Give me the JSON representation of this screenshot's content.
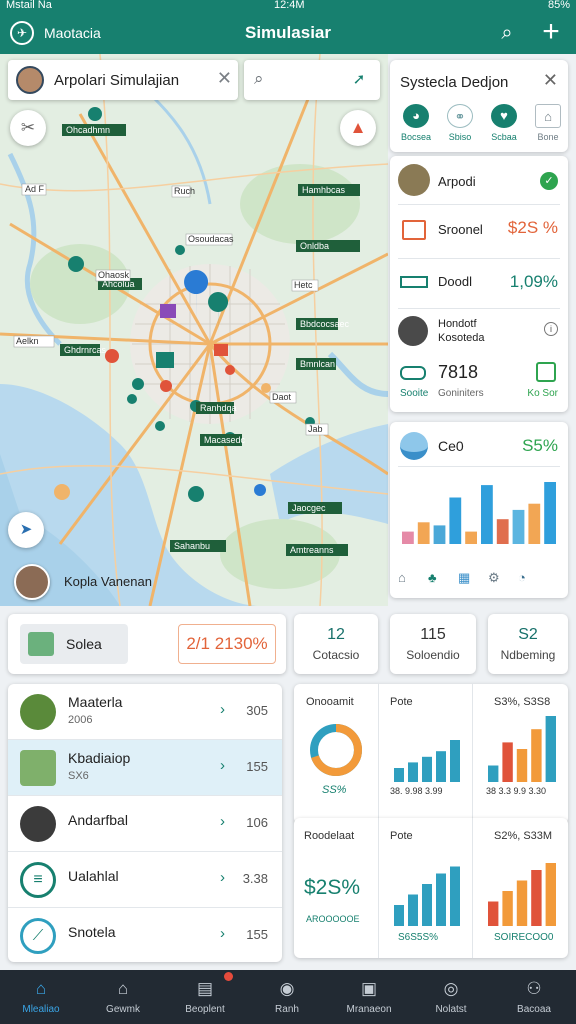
{
  "status_bar": {
    "left": "Mstail Na",
    "center": "12:4M",
    "right": "85%"
  },
  "header": {
    "app_name": "Maotacia",
    "title": "Simulasiar",
    "search_icon": "search-icon",
    "add_icon": "plus-icon"
  },
  "map": {
    "search_text": "Arpolari Simulajian",
    "user_label": "Kopla Vanenan",
    "labels": [
      "Ohcadhmn",
      "Hamhbcas",
      "Ahcolua",
      "Ghdrnrcas",
      "Onldba",
      "Bbdcocsaec",
      "Ranhdqa",
      "Macasedc",
      "Bmnlcan",
      "Jaocgec",
      "Sahanbu",
      "Amtreanns"
    ],
    "small_labels": [
      "Ad F",
      "Ruch",
      "Ohaosk",
      "Osoudacas",
      "Aelkn",
      "Hetc",
      "Jab",
      "Daot"
    ]
  },
  "system_panel": {
    "title": "Systecla Dedjon",
    "items": [
      {
        "label": "Bocsea",
        "icon": "eco-icon",
        "color": "#17806f"
      },
      {
        "label": "Sbiso",
        "icon": "network-icon",
        "color": "#8fb3b8"
      },
      {
        "label": "Scbaa",
        "icon": "heart-icon",
        "color": "#17806f"
      },
      {
        "label": "Bone",
        "icon": "home-icon",
        "color": "#8fa0a8"
      }
    ]
  },
  "metrics": {
    "airport": {
      "label": "Arpodi"
    },
    "rows": [
      {
        "label": "Sroonel",
        "value": "$2S %",
        "color": "#e2643a"
      },
      {
        "label": "Doodl",
        "value": "1,09%",
        "color": "#17806f"
      }
    ],
    "person": {
      "name": "Hondotf",
      "sub": "Kosoteda"
    },
    "count": {
      "value": "7818",
      "left_label": "Sooite",
      "mid_label": "Goniniters",
      "right_label": "Ko Sor"
    }
  },
  "eco_panel": {
    "label": "Ce0",
    "value": "S5%",
    "bars": [
      {
        "v": 0.2,
        "c": "#e58aa7"
      },
      {
        "v": 0.35,
        "c": "#f2a654"
      },
      {
        "v": 0.3,
        "c": "#4aa8d8"
      },
      {
        "v": 0.75,
        "c": "#2f9fdc"
      },
      {
        "v": 0.2,
        "c": "#f2a654"
      },
      {
        "v": 0.95,
        "c": "#2f9fdc"
      },
      {
        "v": 0.4,
        "c": "#e06e4e"
      },
      {
        "v": 0.55,
        "c": "#5bb5e0"
      },
      {
        "v": 0.65,
        "c": "#f2a654"
      },
      {
        "v": 1.0,
        "c": "#2f9fdc"
      }
    ]
  },
  "summary": {
    "chip_label": "Solea",
    "chip_value": "2/1 2130%",
    "stats": [
      {
        "num": "12",
        "sub": "Cotacsio"
      },
      {
        "num": "115",
        "sub": "Soloendio"
      },
      {
        "num": "S2",
        "sub": "Ndbeming"
      }
    ]
  },
  "list": [
    {
      "name": "Maaterla",
      "sub": "2006",
      "count": "305",
      "avatar_color": "#5a8a3a"
    },
    {
      "name": "Kbadiaiop",
      "sub": "SX6",
      "count": "155",
      "avatar_color": "#7fb06b"
    },
    {
      "name": "Andarfbal",
      "sub": "",
      "count": "106",
      "avatar_color": "#3b3b3b"
    },
    {
      "name": "Ualahlal",
      "sub": "",
      "count": "3.38",
      "avatar_color": "#17806f"
    },
    {
      "name": "Snotela",
      "sub": "",
      "count": "155",
      "avatar_color": "#17806f"
    }
  ],
  "charts": {
    "card1": {
      "left_title": "Onooamit",
      "left_value": "SS%",
      "donut": {
        "percent": 0.7,
        "accent": "#f29a3a",
        "base": "#2f9fbf"
      },
      "mid_title": "Pote",
      "right_title": "S3%, S3S8",
      "mid_axis": "38. 9.98 3.99",
      "right_axis": "38 3.3 9.9 3.30",
      "mid_bars": [
        0.25,
        0.35,
        0.45,
        0.55,
        0.75
      ],
      "right_bars": [
        {
          "v": 0.25,
          "c": "#2f9fbf"
        },
        {
          "v": 0.6,
          "c": "#e0533a"
        },
        {
          "v": 0.5,
          "c": "#f29a3a"
        },
        {
          "v": 0.8,
          "c": "#f29a3a"
        },
        {
          "v": 1.0,
          "c": "#2f9fbf"
        }
      ]
    },
    "card2": {
      "left_title": "Roodelaat",
      "left_value": "$2S%",
      "left_sub": "AROOOOOE",
      "mid_title": "Pote",
      "right_title": "S2%, S33M",
      "mid_sub": "S6S5S%",
      "right_sub": "SOIRECOO0",
      "mid_bars": [
        0.3,
        0.45,
        0.6,
        0.75,
        0.85
      ],
      "right_bars": [
        {
          "v": 0.35,
          "c": "#e0533a"
        },
        {
          "v": 0.5,
          "c": "#f29a3a"
        },
        {
          "v": 0.65,
          "c": "#f29a3a"
        },
        {
          "v": 0.8,
          "c": "#e0533a"
        },
        {
          "v": 0.9,
          "c": "#f29a3a"
        }
      ]
    }
  },
  "bottom_nav": [
    {
      "label": "Mlealiao",
      "icon": "home-icon",
      "active": true
    },
    {
      "label": "Gewmk",
      "icon": "building-icon",
      "active": false
    },
    {
      "label": "Beoplent",
      "icon": "document-icon",
      "active": false
    },
    {
      "label": "Ranh",
      "icon": "location-icon",
      "active": false
    },
    {
      "label": "Mranaeon",
      "icon": "image-icon",
      "active": false
    },
    {
      "label": "Nolatst",
      "icon": "compass-icon",
      "active": false
    },
    {
      "label": "Bacoaa",
      "icon": "user-icon",
      "active": false
    }
  ]
}
